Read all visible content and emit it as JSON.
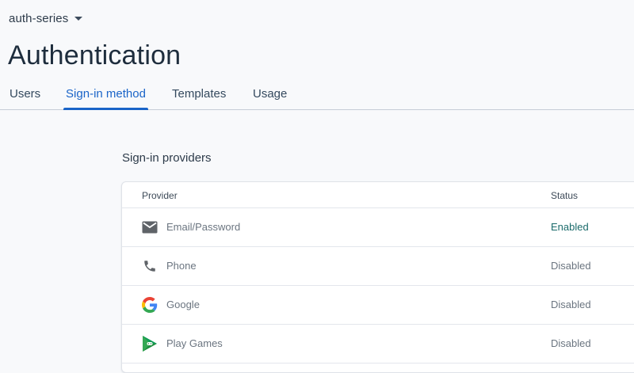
{
  "header": {
    "project_name": "auth-series",
    "title": "Authentication"
  },
  "tabs": [
    {
      "label": "Users",
      "active": false
    },
    {
      "label": "Sign-in method",
      "active": true
    },
    {
      "label": "Templates",
      "active": false
    },
    {
      "label": "Usage",
      "active": false
    }
  ],
  "providers": {
    "section_title": "Sign-in providers",
    "columns": {
      "provider": "Provider",
      "status": "Status"
    },
    "rows": [
      {
        "name": "Email/Password",
        "status": "Enabled",
        "icon": "email-icon"
      },
      {
        "name": "Phone",
        "status": "Disabled",
        "icon": "phone-icon"
      },
      {
        "name": "Google",
        "status": "Disabled",
        "icon": "google-icon"
      },
      {
        "name": "Play Games",
        "status": "Disabled",
        "icon": "play-games-icon"
      }
    ]
  },
  "colors": {
    "accent": "#1a64c8",
    "enabled": "#1b6b6b",
    "disabled": "#6b7580",
    "background": "#f8f9fb"
  }
}
